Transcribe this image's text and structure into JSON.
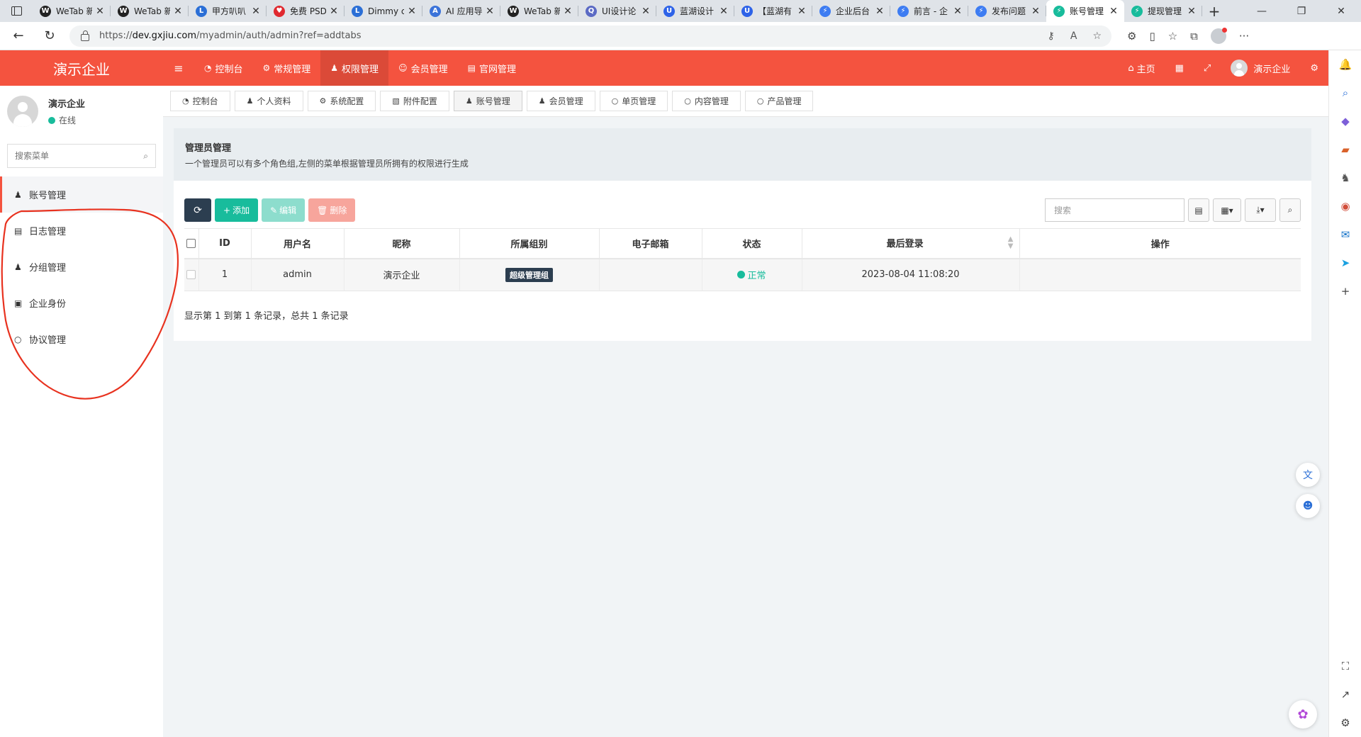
{
  "browser": {
    "tabs": [
      {
        "label": "WeTab 新",
        "icon": "wetab-icon",
        "color": "#222222",
        "glyph": "W"
      },
      {
        "label": "WeTab 新",
        "icon": "wetab-icon",
        "color": "#222222",
        "glyph": "W"
      },
      {
        "label": "甲方叭叭",
        "icon": "lanhu-icon",
        "color": "#2b6fd6",
        "glyph": "L"
      },
      {
        "label": "免费 PSD",
        "icon": "heart-icon",
        "color": "#e0292f",
        "glyph": "♥"
      },
      {
        "label": "Dimmy c",
        "icon": "lanhu-icon",
        "color": "#2b6fd6",
        "glyph": "L"
      },
      {
        "label": "AI 应用导",
        "icon": "ai-icon",
        "color": "#3b73d9",
        "glyph": "A"
      },
      {
        "label": "WeTab 新",
        "icon": "wetab-icon",
        "color": "#222222",
        "glyph": "W"
      },
      {
        "label": "UI设计论",
        "icon": "search-icon",
        "color": "#5b6ac4",
        "glyph": "Q"
      },
      {
        "label": "蓝湖设计",
        "icon": "ui-icon",
        "color": "#2e63e8",
        "glyph": "U"
      },
      {
        "label": "【蓝湖有",
        "icon": "ui-icon",
        "color": "#2e63e8",
        "glyph": "U"
      },
      {
        "label": "企业后台",
        "icon": "lightning-icon",
        "color": "#3d7cf2",
        "glyph": "⚡"
      },
      {
        "label": "前言 - 企",
        "icon": "lightning-icon",
        "color": "#3d7cf2",
        "glyph": "⚡"
      },
      {
        "label": "发布问题",
        "icon": "lightning-icon",
        "color": "#3d7cf2",
        "glyph": "⚡"
      },
      {
        "label": "账号管理",
        "icon": "fast-icon",
        "color": "#18bc9c",
        "glyph": "⚡",
        "active": true
      },
      {
        "label": "提现管理",
        "icon": "fast-icon",
        "color": "#18bc9c",
        "glyph": "⚡"
      }
    ],
    "url_prefix": "https://",
    "url_host": "dev.gxjiu.com",
    "url_path": "/myadmin/auth/admin?ref=addtabs"
  },
  "header": {
    "logo": "演示企业",
    "nav": [
      {
        "label": "控制台",
        "icon": "dashboard-icon",
        "glyph": "◔"
      },
      {
        "label": "常规管理",
        "icon": "cogs-icon",
        "glyph": "⚙"
      },
      {
        "label": "权限管理",
        "icon": "group-icon",
        "glyph": "♟",
        "active": true
      },
      {
        "label": "会员管理",
        "icon": "user-circle-icon",
        "glyph": "☺"
      },
      {
        "label": "官网管理",
        "icon": "list-icon",
        "glyph": "▤"
      }
    ],
    "home": "主页",
    "user": "演示企业"
  },
  "sidebar": {
    "username": "演示企业",
    "status": "在线",
    "search_placeholder": "搜索菜单",
    "items": [
      {
        "label": "账号管理",
        "icon": "user-icon",
        "glyph": "♟",
        "active": true
      },
      {
        "label": "日志管理",
        "icon": "list-alt-icon",
        "glyph": "▤"
      },
      {
        "label": "分组管理",
        "icon": "group-icon",
        "glyph": "♟"
      },
      {
        "label": "企业身份",
        "icon": "id-card-icon",
        "glyph": "▣"
      },
      {
        "label": "协议管理",
        "icon": "circle-icon",
        "glyph": "○"
      }
    ]
  },
  "subtabs": [
    {
      "label": "控制台",
      "icon": "dashboard-icon",
      "glyph": "◔"
    },
    {
      "label": "个人资料",
      "icon": "user-icon",
      "glyph": "♟"
    },
    {
      "label": "系统配置",
      "icon": "cog-icon",
      "glyph": "⚙"
    },
    {
      "label": "附件配置",
      "icon": "file-image-icon",
      "glyph": "▧"
    },
    {
      "label": "账号管理",
      "icon": "user-icon",
      "glyph": "♟",
      "active": true
    },
    {
      "label": "会员管理",
      "icon": "user-icon",
      "glyph": "♟"
    },
    {
      "label": "单页管理",
      "icon": "circle-icon",
      "glyph": "○"
    },
    {
      "label": "内容管理",
      "icon": "circle-icon",
      "glyph": "○"
    },
    {
      "label": "产品管理",
      "icon": "circle-icon",
      "glyph": "○"
    }
  ],
  "panel": {
    "title": "管理员管理",
    "description": "一个管理员可以有多个角色组,左侧的菜单根据管理员所拥有的权限进行生成"
  },
  "toolbar": {
    "add": "添加",
    "edit": "编辑",
    "delete": "删除",
    "search_placeholder": "搜索"
  },
  "table": {
    "columns": [
      "ID",
      "用户名",
      "昵称",
      "所属组别",
      "电子邮箱",
      "状态",
      "最后登录",
      "操作"
    ],
    "rows": [
      {
        "id": "1",
        "username": "admin",
        "nickname": "演示企业",
        "group": "超级管理组",
        "email": "",
        "status": "正常",
        "last_login": "2023-08-04 11:08:20",
        "actions": ""
      }
    ]
  },
  "pagination_info": "显示第 1 到第 1 条记录，总共 1 条记录",
  "colors": {
    "brand": "#f4533f",
    "success": "#18bc9c",
    "dark": "#2c3e50",
    "annotation": "#e8321f"
  }
}
